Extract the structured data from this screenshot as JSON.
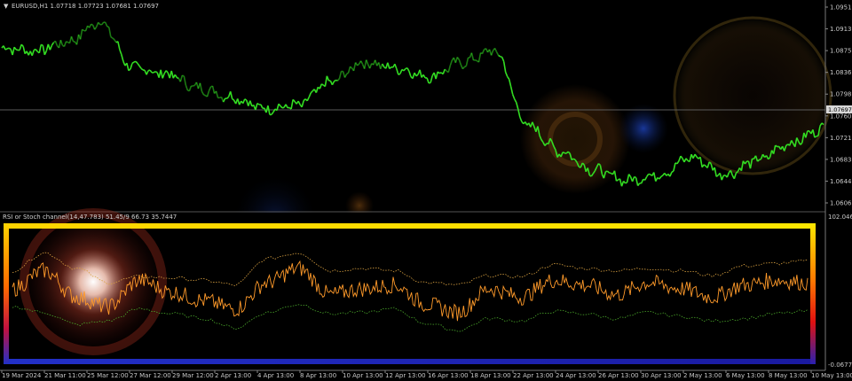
{
  "main_header": "EURUSD,H1  1.07718 1.07723 1.07681 1.07697",
  "indicator_header": "RSI or Stoch channel(14,47.783) 51.45/9 66.73 35.7447",
  "current_price": "1.07697",
  "colors": {
    "background": "#000000",
    "price_line": "#33dd22",
    "rsi_line": "#ff9a2a",
    "upper_band": "#d8a040",
    "lower_band": "#4aa82a",
    "axis_text": "#c8c8c8",
    "current_price_line": "#5a5a5a"
  },
  "icons": {
    "dropdown": "triangle-down-icon"
  },
  "price_axis_labels": [
    "1.09515",
    "1.09135",
    "1.08750",
    "1.08365",
    "1.07980",
    "1.07600",
    "1.07215",
    "1.06830",
    "1.06445",
    "1.06065"
  ],
  "indicator_axis_top": "102.046",
  "indicator_axis_bottom": "-0.0677",
  "time_axis_labels": [
    "19 Mar 2024",
    "21 Mar 11:00",
    "25 Mar 12:00",
    "27 Mar 12:00",
    "29 Mar 12:00",
    "2 Apr 13:00",
    "4 Apr 13:00",
    "8 Apr 13:00",
    "10 Apr 13:00",
    "12 Apr 13:00",
    "16 Apr 13:00",
    "18 Apr 13:00",
    "22 Apr 13:00",
    "24 Apr 13:00",
    "26 Apr 13:00",
    "30 Apr 13:00",
    "2 May 13:00",
    "6 May 13:00",
    "8 May 13:00",
    "10 May 13:00"
  ],
  "chart_data": {
    "type": "line",
    "main_series": {
      "x_index": [
        0,
        4,
        8,
        12,
        16,
        20,
        24,
        28,
        32,
        36,
        40,
        44,
        48,
        52,
        56,
        60,
        64,
        68,
        72,
        76,
        80,
        84,
        88,
        92,
        96,
        100
      ],
      "close": [
        1.088,
        1.0875,
        1.089,
        1.0925,
        1.0845,
        1.0835,
        1.081,
        1.0795,
        1.0775,
        1.078,
        1.082,
        1.0855,
        1.0845,
        1.083,
        1.0855,
        1.0875,
        1.0745,
        1.07,
        1.0668,
        1.065,
        1.066,
        1.069,
        1.066,
        1.0685,
        1.0715,
        1.074
      ],
      "ylim": [
        1.0597,
        1.096
      ]
    },
    "indicator_series": {
      "x_index": [
        0,
        4,
        8,
        12,
        16,
        20,
        24,
        28,
        32,
        36,
        40,
        44,
        48,
        52,
        56,
        60,
        64,
        68,
        72,
        76,
        80,
        84,
        88,
        92,
        96,
        100
      ],
      "rsi": [
        55,
        70,
        48,
        40,
        62,
        52,
        45,
        38,
        60,
        72,
        50,
        55,
        58,
        42,
        35,
        55,
        48,
        62,
        58,
        50,
        60,
        55,
        48,
        58,
        62,
        60
      ],
      "upper": [
        70,
        85,
        72,
        60,
        65,
        64,
        62,
        58,
        80,
        85,
        70,
        72,
        70,
        60,
        58,
        66,
        65,
        75,
        72,
        70,
        72,
        70,
        66,
        74,
        76,
        78
      ],
      "lower": [
        40,
        35,
        25,
        28,
        38,
        34,
        30,
        22,
        35,
        42,
        34,
        35,
        38,
        26,
        20,
        30,
        28,
        36,
        34,
        30,
        35,
        32,
        28,
        30,
        34,
        36
      ],
      "ylim": [
        0,
        100
      ]
    }
  }
}
